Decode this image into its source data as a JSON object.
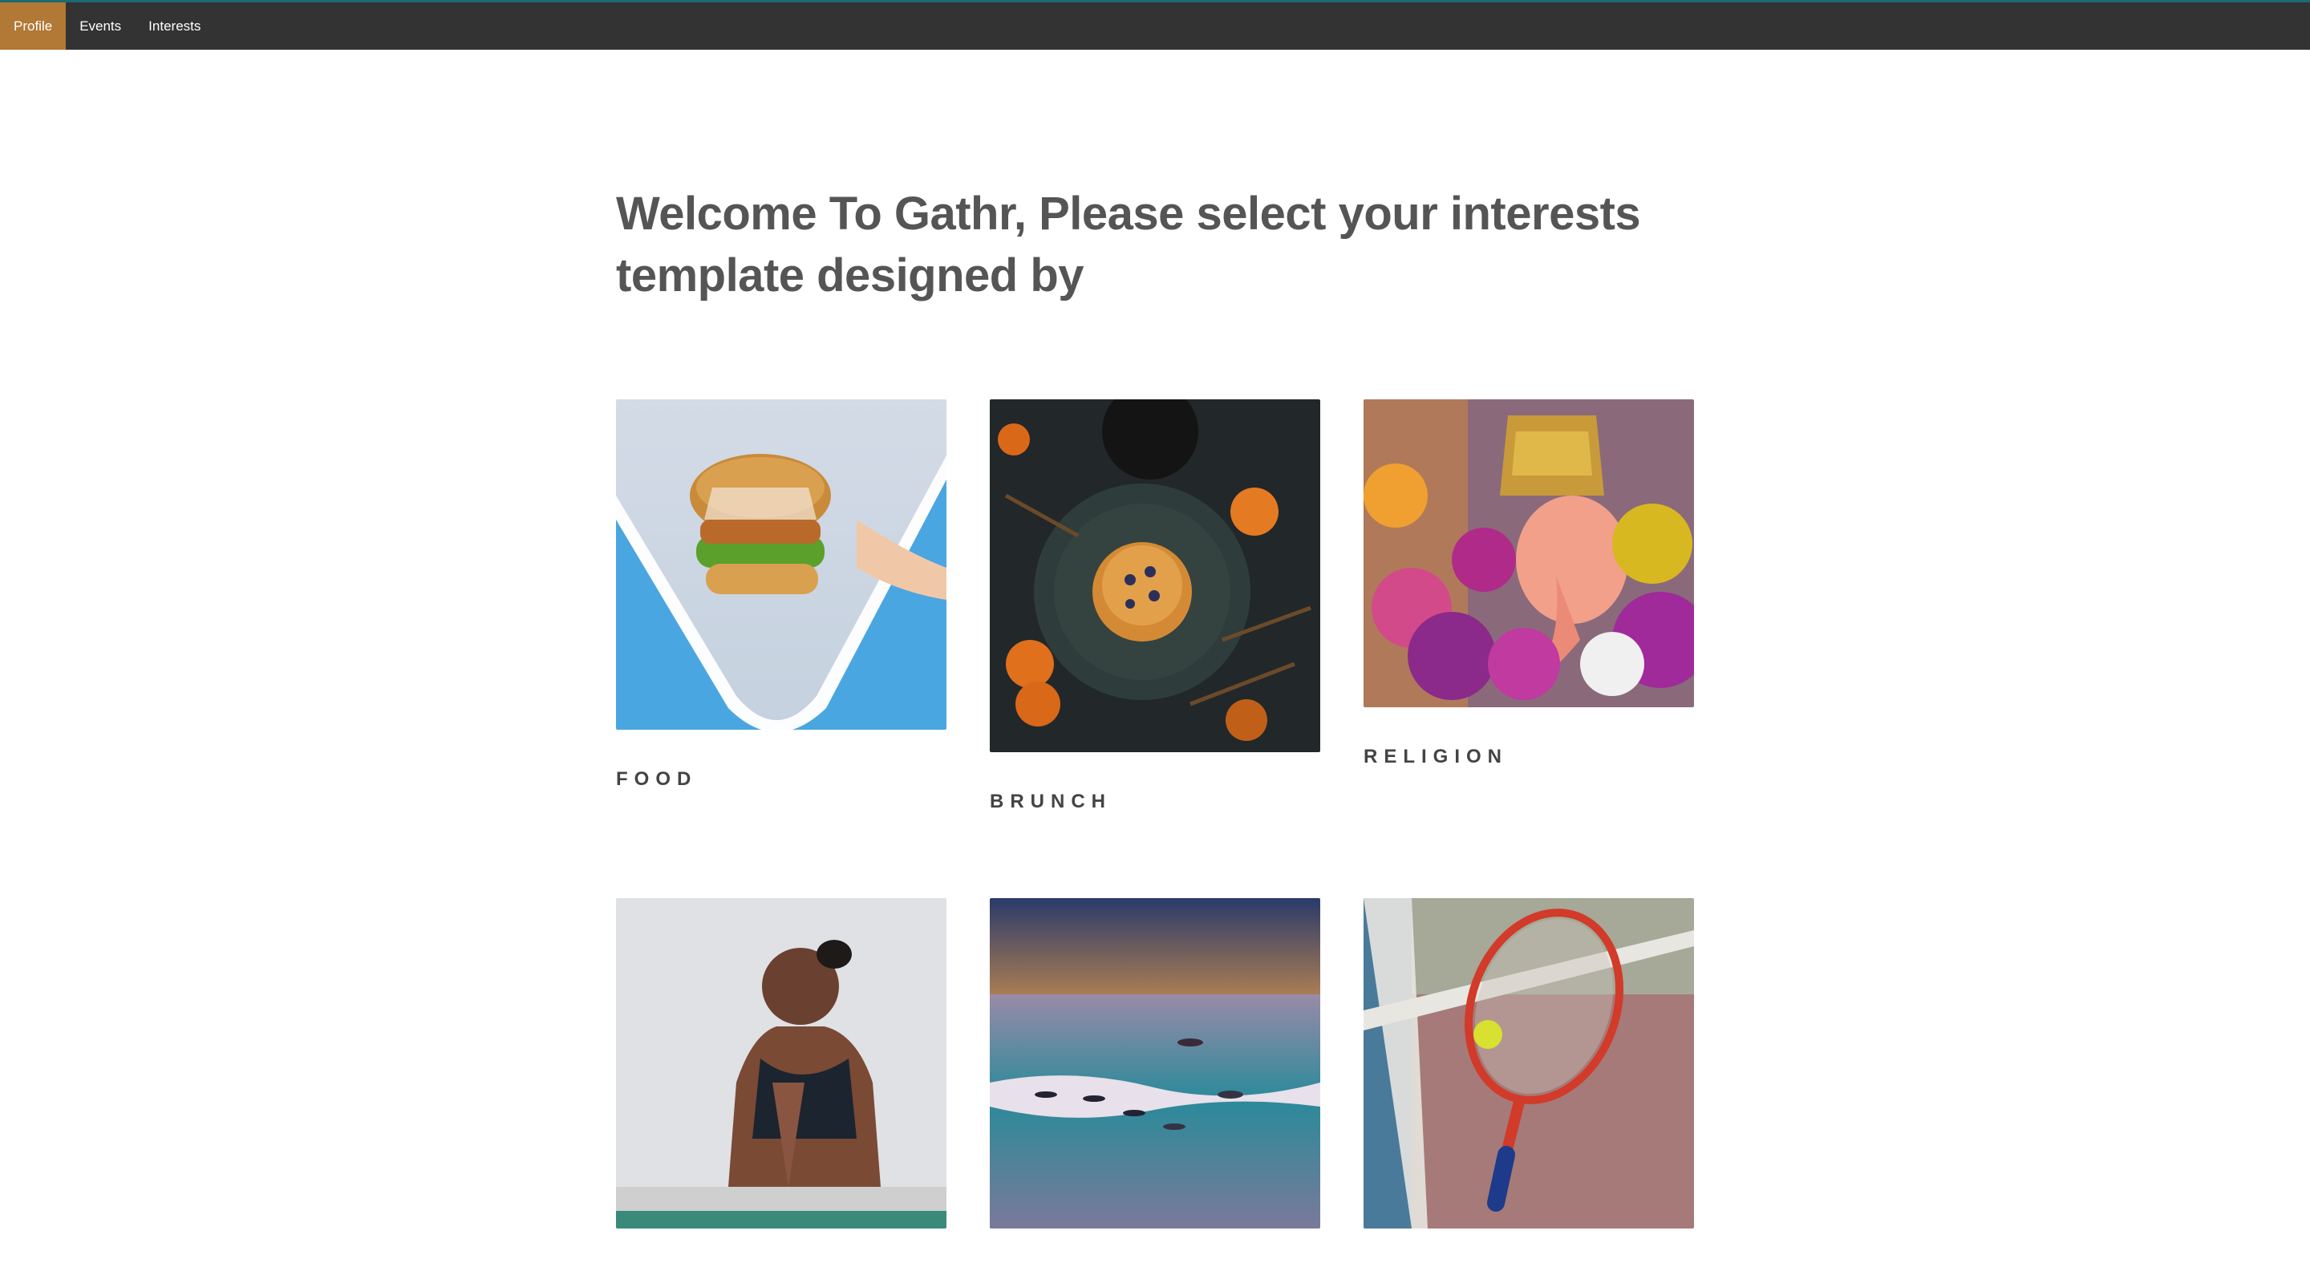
{
  "nav": {
    "items": [
      {
        "label": "Profile",
        "active": true
      },
      {
        "label": "Events",
        "active": false
      },
      {
        "label": "Interests",
        "active": false
      }
    ]
  },
  "main": {
    "title_line1": "Welcome To Gathr, Please select your interests",
    "title_line2": "template designed by"
  },
  "interests": [
    {
      "label": "FOOD",
      "image": "burger-photo"
    },
    {
      "label": "BRUNCH",
      "image": "pancakes-photo"
    },
    {
      "label": "RELIGION",
      "image": "ganesha-photo"
    },
    {
      "label": "",
      "image": "yoga-photo"
    },
    {
      "label": "",
      "image": "dolphins-photo"
    },
    {
      "label": "",
      "image": "tennis-racket-photo"
    }
  ],
  "colors": {
    "navbar_bg": "#333333",
    "active_tab": "#b27836",
    "heading_text": "#555555"
  }
}
